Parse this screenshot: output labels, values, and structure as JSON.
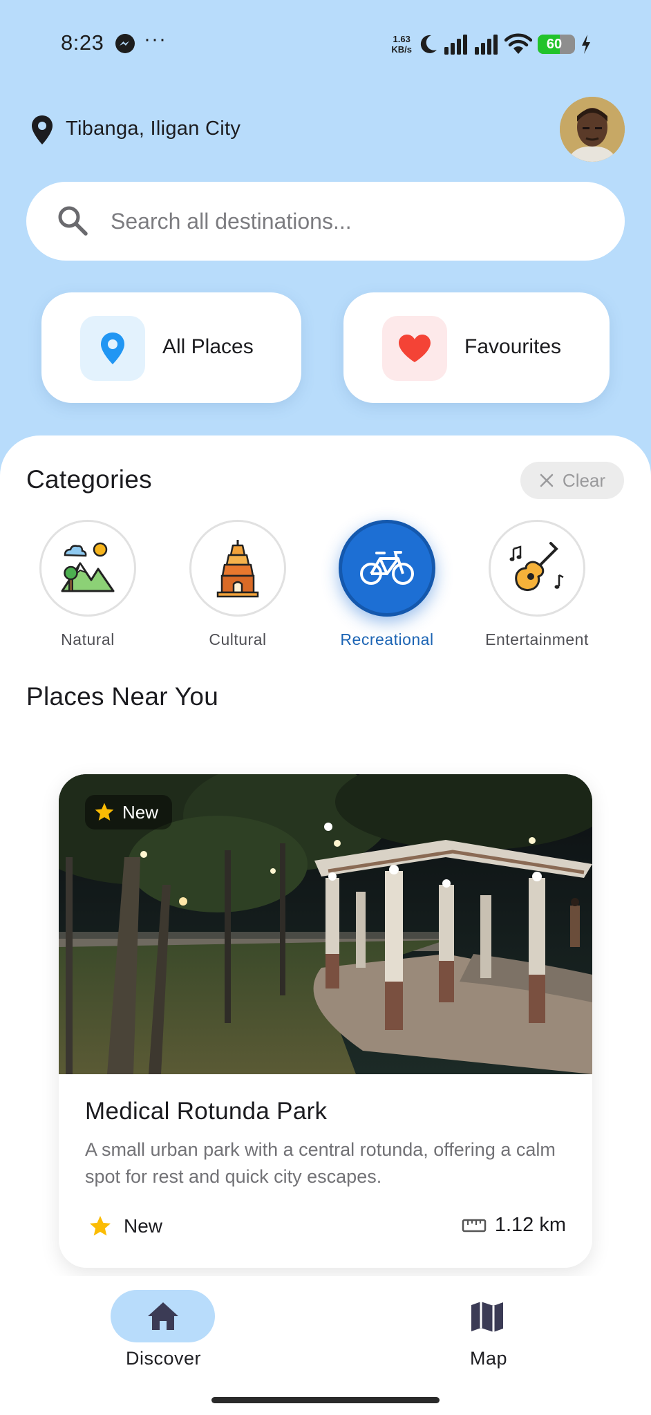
{
  "status_bar": {
    "time": "8:23",
    "dots": "···",
    "speed_value": "1.63",
    "speed_unit": "KB/s",
    "battery": "60",
    "battery_level": 0.6,
    "messenger_icon": "messenger-icon",
    "icons": [
      "moon-icon",
      "signal-icon",
      "signal-icon",
      "wifi-icon",
      "charging-icon"
    ]
  },
  "header": {
    "location": "Tibanga, Iligan City",
    "location_icon": "location-pin-icon",
    "avatar": "user-avatar"
  },
  "search": {
    "placeholder": "Search all destinations...",
    "value": ""
  },
  "quick_actions": [
    {
      "label": "All Places",
      "icon": "map-pin-icon",
      "color": "#2196f3",
      "bg": "#e3f2fd"
    },
    {
      "label": "Favourites",
      "icon": "heart-icon",
      "color": "#f44336",
      "bg": "#fde9ea"
    }
  ],
  "categories": {
    "title": "Categories",
    "clear_label": "Clear",
    "items": [
      {
        "label": "Natural",
        "icon": "mountain-icon",
        "selected": false
      },
      {
        "label": "Cultural",
        "icon": "pagoda-icon",
        "selected": false
      },
      {
        "label": "Recreational",
        "icon": "bicycle-icon",
        "selected": true
      },
      {
        "label": "Entertainment",
        "icon": "guitar-icon",
        "selected": false
      }
    ]
  },
  "places": {
    "title": "Places Near You",
    "items": [
      {
        "badge": "New",
        "name": "Medical Rotunda Park",
        "description": "A small urban park with a central rotunda, offering a calm spot for rest and quick city escapes.",
        "rating": "New",
        "distance": "1.12 km",
        "photo": "park-rotunda-photo"
      }
    ]
  },
  "bottom_nav": {
    "items": [
      {
        "label": "Discover",
        "icon": "home-icon",
        "active": true
      },
      {
        "label": "Map",
        "icon": "map-icon",
        "active": false
      }
    ]
  },
  "colors": {
    "background": "#b8dcfb",
    "accent": "#1d6fd4",
    "star": "#fbbc04"
  }
}
